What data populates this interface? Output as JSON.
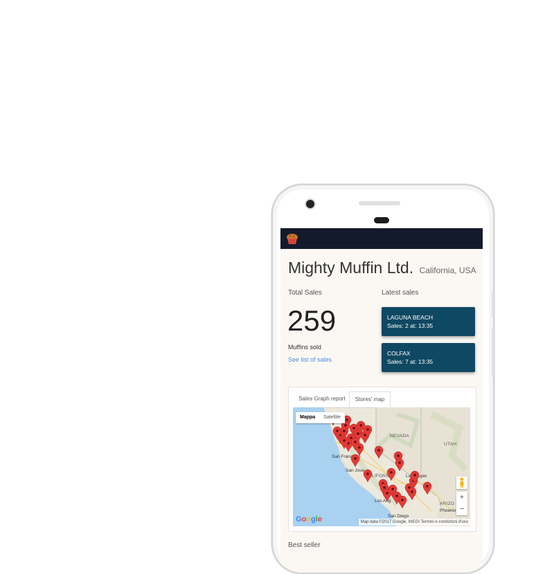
{
  "app": {
    "title": "Mighty Muffin Ltd.",
    "subtitle": "California, USA",
    "logo_icon": "muffin-icon"
  },
  "totals": {
    "label": "Total Sales",
    "value": "259",
    "unit_label": "Muffins sold",
    "link": "See list of sales"
  },
  "latest": {
    "label": "Latest sales",
    "items": [
      {
        "title": "LAGUNA BEACH",
        "sub": "Sales: 2 at: 13:35"
      },
      {
        "title": "COLFAX",
        "sub": "Sales: 7 at: 13:35"
      }
    ]
  },
  "tabs": [
    {
      "label": "Sales Graph report",
      "active": false
    },
    {
      "label": "Stores' map",
      "active": true
    }
  ],
  "map": {
    "type_buttons": [
      "Mappa",
      "Satellite"
    ],
    "zoom_in": "+",
    "zoom_out": "−",
    "logo": "Google",
    "attribution": "Map data ©2017 Google, INEGI   Termini e condizioni d'uso",
    "region_labels": [
      "NEVADA",
      "UTAH",
      "CALIFORNIA",
      "ARIZO"
    ],
    "city_labels": [
      "San Francisco",
      "San Jose",
      "Las Vegas",
      "Los Ang",
      "San Diego",
      "Phoenix"
    ],
    "marker_icon": "map-pin-icon",
    "colors": {
      "marker": "#e53935",
      "land": "#e7e2d4",
      "ocean": "#a9d1f0"
    }
  },
  "best_seller": {
    "label": "Best seller"
  },
  "colors": {
    "appbar": "#131a2b",
    "card": "#0f4862",
    "link": "#4a8fe0",
    "page": "#fbf8f4"
  }
}
